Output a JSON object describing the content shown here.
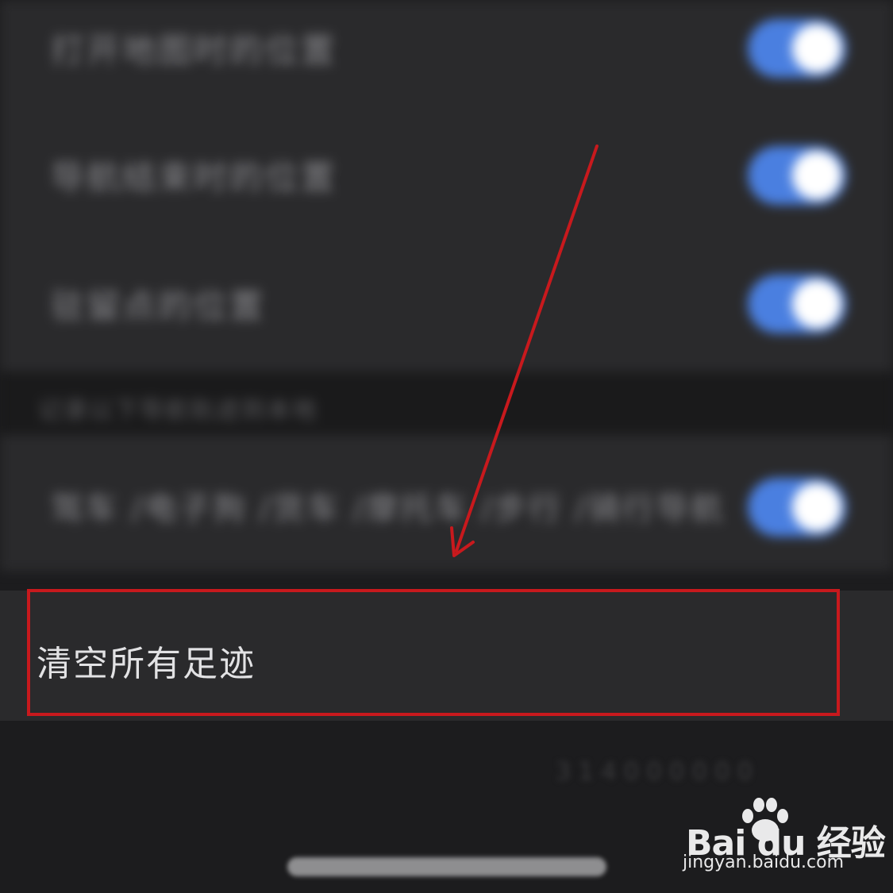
{
  "settings": {
    "rows": [
      {
        "label": "打开地图时的位置",
        "toggle_on": true
      },
      {
        "label": "导航结束时的位置",
        "toggle_on": true
      },
      {
        "label": "驻留点的位置",
        "toggle_on": true
      }
    ],
    "section_header": "记录以下导航轨迹到本地",
    "nav_row": {
      "label": "驾车 /电子狗 /货车 /摩托车 /步行 /骑行导航",
      "toggle_on": true
    }
  },
  "clear_row": {
    "label": "清空所有足迹"
  },
  "bottom": {
    "faint_text": "3 1 4 0 0 0 0 0 0"
  },
  "watermark": {
    "brand": "Bai  du 经验",
    "url": "jingyan.baidu.com"
  },
  "colors": {
    "toggle_on": "#4a7fe0",
    "highlight": "#c8191d",
    "background": "#1c1c1e",
    "cell": "#2a2a2c"
  }
}
